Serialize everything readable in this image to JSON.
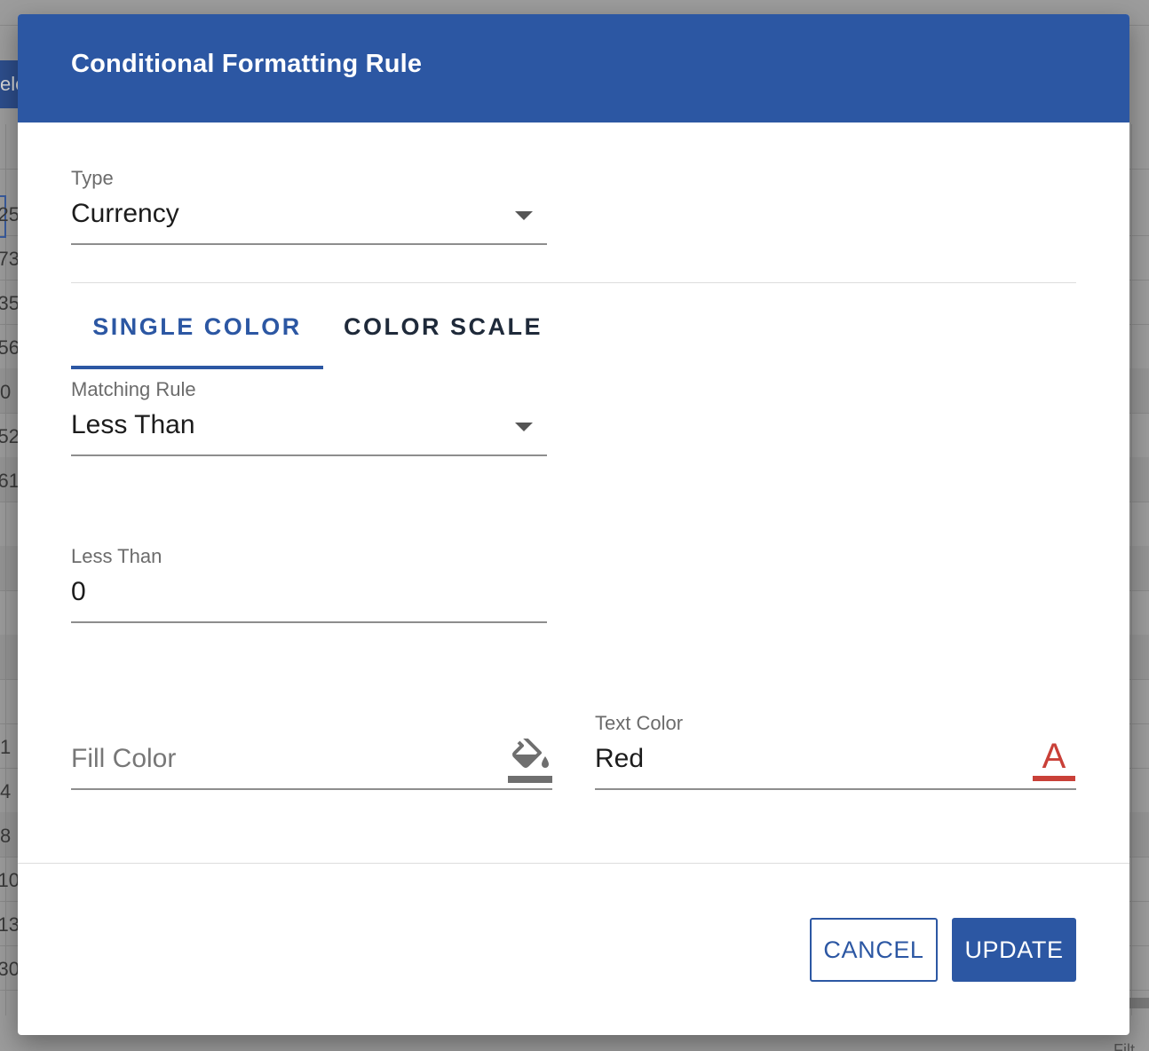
{
  "backdrop": {
    "left_button_label": "ele",
    "cell_fragments": [
      "25",
      "73",
      "35",
      "56",
      "0",
      "52",
      "61",
      "1",
      "4",
      "8",
      "10",
      "13",
      "30"
    ],
    "bottom_right_text": "Filt"
  },
  "dialog": {
    "title": "Conditional Formatting Rule",
    "type_field": {
      "label": "Type",
      "value": "Currency"
    },
    "tabs": [
      {
        "label": "SINGLE COLOR",
        "active": true
      },
      {
        "label": "COLOR SCALE",
        "active": false
      }
    ],
    "matching_rule": {
      "label": "Matching Rule",
      "value": "Less Than"
    },
    "threshold": {
      "label": "Less Than",
      "value": "0"
    },
    "fill_color": {
      "placeholder": "Fill Color",
      "icon": "paint-bucket-icon"
    },
    "text_color": {
      "label": "Text Color",
      "value": "Red",
      "icon": "text-color-icon",
      "icon_glyph": "A",
      "icon_color": "#c94038"
    },
    "buttons": {
      "cancel": "CANCEL",
      "update": "UPDATE"
    }
  },
  "colors": {
    "primary": "#2c57a3",
    "text_color_swatch": "#c94038"
  }
}
